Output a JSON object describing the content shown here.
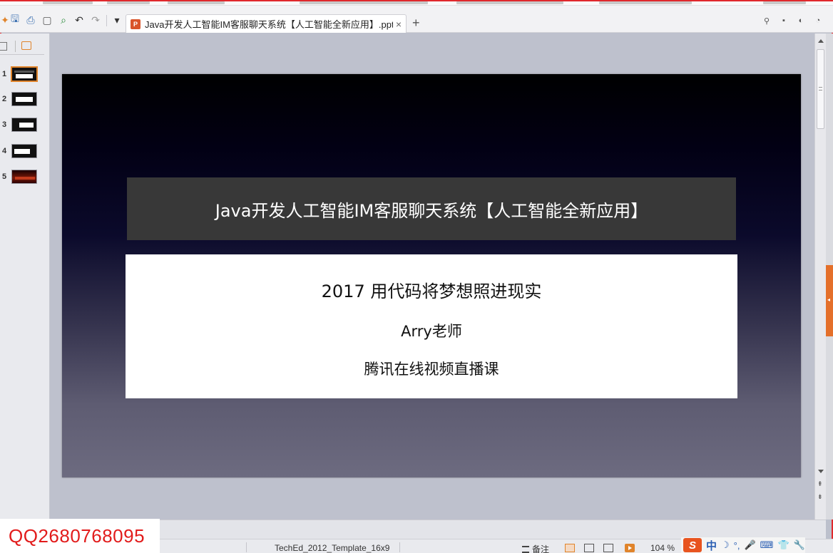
{
  "app": {
    "document_tab_title": "Java开发人工智能IM客服聊天系统【人工智能全新应用】.ppt",
    "tab_close_glyph": "×",
    "new_tab_glyph": "+",
    "file_badge": "P"
  },
  "quick_access": {
    "icons": [
      "bookmark-icon",
      "save-icon",
      "print-icon",
      "print-preview-icon",
      "find-icon",
      "undo-icon",
      "redo-icon",
      "customize-icon"
    ],
    "glyphs": {
      "save": "🖫",
      "print": "⎙",
      "undo": "↶",
      "redo": "↷",
      "customize": "▾"
    }
  },
  "right_toolbar": {
    "icons": [
      "pin-icon",
      "minimize-ribbon-icon",
      "help-icon",
      "settings-icon"
    ],
    "glyphs": [
      "⚲",
      "▪",
      "◐",
      "◔"
    ]
  },
  "thumbnails": [
    {
      "number": "1",
      "active": true
    },
    {
      "number": "2",
      "active": false
    },
    {
      "number": "3",
      "active": false
    },
    {
      "number": "4",
      "active": false
    },
    {
      "number": "5",
      "active": false
    }
  ],
  "slide": {
    "title": "Java开发人工智能IM客服聊天系统【人工智能全新应用】",
    "subtitle_line1": "2017 用代码将梦想照进现实",
    "subtitle_line2": "Arry老师",
    "subtitle_line3": "腾讯在线视频直播课"
  },
  "status_bar": {
    "template_name": "TechEd_2012_Template_16x9",
    "notes_label": "备注",
    "zoom": "104 %"
  },
  "ime": {
    "logo": "S",
    "mode": "中",
    "glyphs": [
      "☽",
      "°,",
      "🎤",
      "⌨",
      "👕",
      "🔧"
    ]
  },
  "watermark": {
    "qq": "QQ2680768095"
  },
  "scrollbar": {
    "prev_page_glyph": "⇞",
    "next_page_glyph": "⇟",
    "collapse_glyph": "◂"
  },
  "colors": {
    "accent_orange": "#e0842b",
    "frame_red": "#e0282c",
    "watermark_red": "#e21b1b",
    "title_box": "#383838"
  }
}
